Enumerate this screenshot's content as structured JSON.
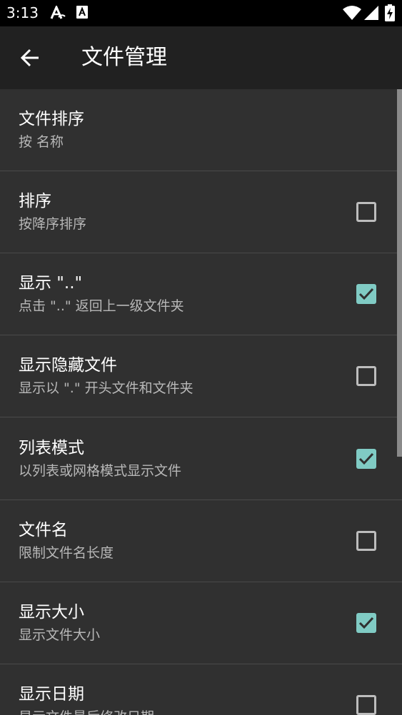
{
  "status_bar": {
    "time": "3:13",
    "icons": [
      "text-a-icon",
      "font-a-icon",
      "wifi-icon",
      "signal-icon",
      "battery-charging-icon"
    ]
  },
  "app_bar": {
    "back_icon": "arrow-left-icon",
    "title": "文件管理"
  },
  "preferences": [
    {
      "title": "文件排序",
      "summary": "按 名称",
      "has_checkbox": false
    },
    {
      "title": "排序",
      "summary": "按降序排序",
      "has_checkbox": true,
      "checked": false
    },
    {
      "title": "显示 \"..\"",
      "summary": "点击 \"..\" 返回上一级文件夹",
      "has_checkbox": true,
      "checked": true
    },
    {
      "title": "显示隐藏文件",
      "summary": "显示以 \".\" 开头文件和文件夹",
      "has_checkbox": true,
      "checked": false
    },
    {
      "title": "列表模式",
      "summary": "以列表或网格模式显示文件",
      "has_checkbox": true,
      "checked": true
    },
    {
      "title": "文件名",
      "summary": "限制文件名长度",
      "has_checkbox": true,
      "checked": false
    },
    {
      "title": "显示大小",
      "summary": "显示文件大小",
      "has_checkbox": true,
      "checked": true
    },
    {
      "title": "显示日期",
      "summary": "显示文件最后修改日期",
      "has_checkbox": true,
      "checked": false
    }
  ],
  "colors": {
    "background": "#303030",
    "app_bar": "#212121",
    "accent": "#80cbc4",
    "summary_text": "#b8b8b8"
  }
}
